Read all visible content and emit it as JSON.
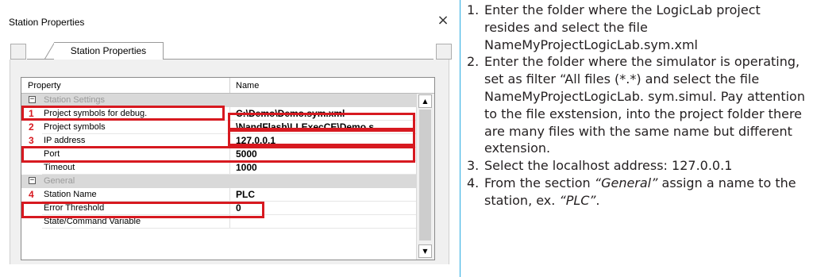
{
  "window": {
    "title": "Station Properties",
    "close_glyph": "×",
    "tab_label": "Station Properties"
  },
  "grid": {
    "col_property": "Property",
    "col_name": "Name",
    "categories": {
      "station": "Station Settings",
      "general": "General"
    },
    "rows": {
      "symbols_debug": {
        "marker": "1",
        "property": "Project symbols for debug.",
        "value": "C:\\Demo\\Demo.sym.xml"
      },
      "symbols": {
        "marker": "2",
        "property": "Project symbols",
        "value": "\\NandFlash\\LLExecCE\\Demo.s..."
      },
      "ip": {
        "marker": "3",
        "property": "IP address",
        "value": "127.0.0.1"
      },
      "port": {
        "property": "Port",
        "value": "5000"
      },
      "timeout": {
        "property": "Timeout",
        "value": "1000"
      },
      "station_name": {
        "marker": "4",
        "property": "Station Name",
        "value": "PLC"
      },
      "error_threshold": {
        "property": "Error Threshold",
        "value": "0"
      },
      "state_command": {
        "property": "State/Command Variable",
        "value": ""
      }
    },
    "expander_glyph": "−",
    "scroll_up_glyph": "▲",
    "scroll_down_glyph": "▼"
  },
  "colors": {
    "accent_red": "#d71920",
    "separator_blue": "#29abe2"
  },
  "instructions": {
    "step1": {
      "n": "1.",
      "text": "Enter the folder where the LogicLab project resides and select the file NameMyProjectLogicLab.sym.xml"
    },
    "step2": {
      "n": "2.",
      "text": "Enter the folder where the simulator is operating, set as filter “All files (*.*) and select the file NameMyProjectLogicLab. sym.simul. Pay attention to the file exstension, into the project folder there are many files with the same name but different extension."
    },
    "step3": {
      "n": "3.",
      "text": "Select the localhost address: 127.0.0.1"
    },
    "step4": {
      "n": "4.",
      "text_a": "From the section ",
      "italic_a": "“General”",
      "text_b": " assign a name to the station, ex. ",
      "italic_b": "“PLC”",
      "text_c": "."
    }
  }
}
